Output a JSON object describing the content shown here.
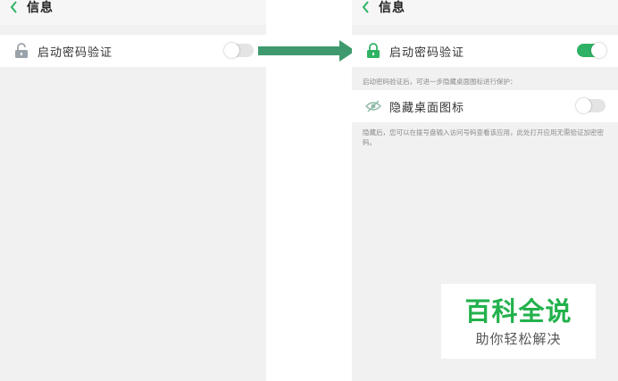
{
  "left": {
    "header_title": "信息",
    "row_label": "启动密码验证",
    "toggle_state": "off"
  },
  "right": {
    "header_title": "信息",
    "row1_label": "启动密码验证",
    "row1_toggle": "on",
    "note1": "启动密码验证后，可进一步隐藏桌面图标进行保护：",
    "row2_label": "隐藏桌面图标",
    "row2_toggle": "off",
    "note2": "隐藏后，您可以在拨号盘输入访问号码查看该应用，此处打开应用无需验证加密密码。"
  },
  "watermark": {
    "title": "百科全说",
    "subtitle": "助你轻松解决"
  },
  "colors": {
    "accent_green": "#2fb265",
    "arrow_green": "#3e9a6e",
    "watermark_green": "#22b14c"
  },
  "icons": [
    "back-chevron-icon",
    "unlocked-padlock-icon",
    "locked-padlock-icon",
    "hidden-eye-icon",
    "right-arrow-icon"
  ]
}
